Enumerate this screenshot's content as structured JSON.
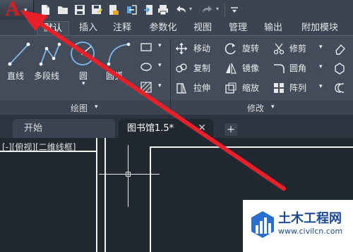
{
  "app": {
    "logo_letter": "A"
  },
  "quick_access": {
    "icons": [
      "new-file-icon",
      "open-folder-icon",
      "save-icon",
      "save-as-icon",
      "export-icon",
      "share-icon",
      "print-icon",
      "undo-icon",
      "redo-icon",
      "customize-icon"
    ]
  },
  "ribbon_tabs": [
    {
      "label": "默认",
      "active": true
    },
    {
      "label": "插入"
    },
    {
      "label": "注释"
    },
    {
      "label": "参数化"
    },
    {
      "label": "视图"
    },
    {
      "label": "管理"
    },
    {
      "label": "输出"
    },
    {
      "label": "附加模块"
    }
  ],
  "draw_panel": {
    "title": "绘图",
    "tools": {
      "line": "直线",
      "polyline": "多段线",
      "circle": "圆",
      "arc": "圆弧"
    }
  },
  "modify_panel": {
    "title": "修改",
    "tools": {
      "move": "移动",
      "rotate": "旋转",
      "trim": "修剪",
      "copy": "复制",
      "mirror": "镜像",
      "fillet": "圆角",
      "stretch": "拉伸",
      "scale": "缩放",
      "array": "阵列"
    }
  },
  "doc_tabs": {
    "start": "开始",
    "current": "图书馆1.5*",
    "close_glyph": "✕",
    "new_glyph": "+"
  },
  "viewport": {
    "label": "[-][俯视][二维线框]"
  },
  "watermark": {
    "title": "土木工程网",
    "url": "www.civilcn.com"
  },
  "colors": {
    "accent_red": "#d21f25",
    "arrow_red": "#e8202a",
    "ribbon_bg": "#434c5a",
    "canvas_bg": "#212830",
    "watermark_blue": "#1c4a94"
  }
}
